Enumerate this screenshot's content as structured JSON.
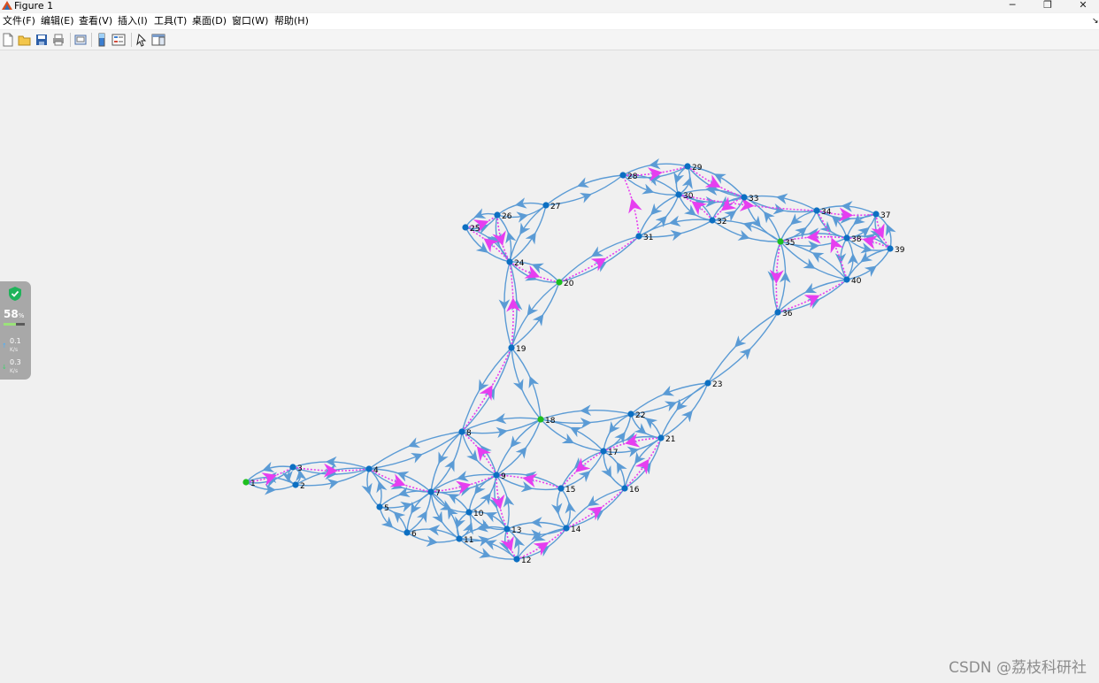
{
  "window": {
    "title": "Figure 1",
    "minimize_glyph": "─",
    "restore_glyph": "❐",
    "close_glyph": "✕"
  },
  "menu": [
    "文件(F)",
    "编辑(E)",
    "查看(V)",
    "插入(I)",
    "工具(T)",
    "桌面(D)",
    "窗口(W)",
    "帮助(H)"
  ],
  "toolbar": {
    "icons": [
      "new-figure-icon",
      "open-file-icon",
      "save-icon",
      "print-icon",
      "print-preview-icon",
      "colorbar-icon",
      "legend-icon",
      "select-pointer-icon",
      "property-editor-icon"
    ]
  },
  "monitor": {
    "percent": "58",
    "percent_unit": "%",
    "percent_value": 0.58,
    "upload_rate": "0.1",
    "download_rate": "0.3",
    "rate_unit": "K/s"
  },
  "watermark": "CSDN @荔枝科研社",
  "colors": {
    "edge": "#5b9bd5",
    "highlight_edge": "#e63ef0",
    "node": "#0c6fc2",
    "special_node": "#1fbf1f",
    "background": "#f0f0f0"
  },
  "chart_data": {
    "type": "network-graph",
    "nodes": [
      {
        "id": "1",
        "special": true
      },
      {
        "id": "2"
      },
      {
        "id": "3"
      },
      {
        "id": "4"
      },
      {
        "id": "5"
      },
      {
        "id": "6"
      },
      {
        "id": "7"
      },
      {
        "id": "8"
      },
      {
        "id": "9"
      },
      {
        "id": "10"
      },
      {
        "id": "11"
      },
      {
        "id": "12"
      },
      {
        "id": "13"
      },
      {
        "id": "14"
      },
      {
        "id": "15"
      },
      {
        "id": "16"
      },
      {
        "id": "17"
      },
      {
        "id": "18",
        "special": true
      },
      {
        "id": "19"
      },
      {
        "id": "20",
        "special": true
      },
      {
        "id": "21"
      },
      {
        "id": "22"
      },
      {
        "id": "23"
      },
      {
        "id": "24"
      },
      {
        "id": "25"
      },
      {
        "id": "26"
      },
      {
        "id": "27"
      },
      {
        "id": "28"
      },
      {
        "id": "29"
      },
      {
        "id": "30"
      },
      {
        "id": "31"
      },
      {
        "id": "32"
      },
      {
        "id": "33"
      },
      {
        "id": "34"
      },
      {
        "id": "35",
        "special": true
      },
      {
        "id": "36"
      },
      {
        "id": "37"
      },
      {
        "id": "38"
      },
      {
        "id": "39"
      },
      {
        "id": "40"
      }
    ],
    "edges": [
      [
        "1",
        "2"
      ],
      [
        "1",
        "3"
      ],
      [
        "2",
        "3"
      ],
      [
        "2",
        "4"
      ],
      [
        "3",
        "4"
      ],
      [
        "4",
        "5"
      ],
      [
        "4",
        "7"
      ],
      [
        "4",
        "8"
      ],
      [
        "5",
        "6"
      ],
      [
        "5",
        "7"
      ],
      [
        "6",
        "7"
      ],
      [
        "6",
        "11"
      ],
      [
        "7",
        "8"
      ],
      [
        "7",
        "9"
      ],
      [
        "7",
        "10"
      ],
      [
        "7",
        "11"
      ],
      [
        "8",
        "9"
      ],
      [
        "8",
        "18"
      ],
      [
        "8",
        "19"
      ],
      [
        "9",
        "10"
      ],
      [
        "9",
        "13"
      ],
      [
        "9",
        "15"
      ],
      [
        "9",
        "18"
      ],
      [
        "10",
        "11"
      ],
      [
        "10",
        "13"
      ],
      [
        "11",
        "12"
      ],
      [
        "11",
        "13"
      ],
      [
        "12",
        "13"
      ],
      [
        "12",
        "14"
      ],
      [
        "13",
        "14"
      ],
      [
        "14",
        "15"
      ],
      [
        "14",
        "16"
      ],
      [
        "15",
        "17"
      ],
      [
        "16",
        "17"
      ],
      [
        "16",
        "21"
      ],
      [
        "17",
        "18"
      ],
      [
        "17",
        "21"
      ],
      [
        "17",
        "22"
      ],
      [
        "18",
        "19"
      ],
      [
        "18",
        "22"
      ],
      [
        "19",
        "20"
      ],
      [
        "19",
        "24"
      ],
      [
        "20",
        "24"
      ],
      [
        "20",
        "31"
      ],
      [
        "21",
        "22"
      ],
      [
        "21",
        "23"
      ],
      [
        "22",
        "23"
      ],
      [
        "23",
        "36"
      ],
      [
        "24",
        "25"
      ],
      [
        "24",
        "26"
      ],
      [
        "24",
        "27"
      ],
      [
        "25",
        "26"
      ],
      [
        "26",
        "27"
      ],
      [
        "27",
        "28"
      ],
      [
        "28",
        "29"
      ],
      [
        "28",
        "30"
      ],
      [
        "29",
        "30"
      ],
      [
        "29",
        "33"
      ],
      [
        "30",
        "31"
      ],
      [
        "30",
        "32"
      ],
      [
        "30",
        "33"
      ],
      [
        "31",
        "32"
      ],
      [
        "32",
        "33"
      ],
      [
        "32",
        "35"
      ],
      [
        "33",
        "34"
      ],
      [
        "33",
        "35"
      ],
      [
        "34",
        "35"
      ],
      [
        "34",
        "37"
      ],
      [
        "34",
        "38"
      ],
      [
        "35",
        "36"
      ],
      [
        "35",
        "38"
      ],
      [
        "35",
        "40"
      ],
      [
        "36",
        "40"
      ],
      [
        "37",
        "38"
      ],
      [
        "37",
        "39"
      ],
      [
        "38",
        "39"
      ],
      [
        "38",
        "40"
      ],
      [
        "39",
        "40"
      ]
    ],
    "highlight_path": [
      "1",
      "3",
      "4",
      "7",
      "9",
      "13",
      "12",
      "14",
      "16",
      "21",
      "17",
      "15",
      "9",
      "8",
      "19",
      "24",
      "25",
      "26",
      "24",
      "20",
      "31",
      "28",
      "29",
      "33",
      "32",
      "30",
      "34",
      "37",
      "39",
      "38",
      "35",
      "36",
      "40",
      "34"
    ]
  }
}
